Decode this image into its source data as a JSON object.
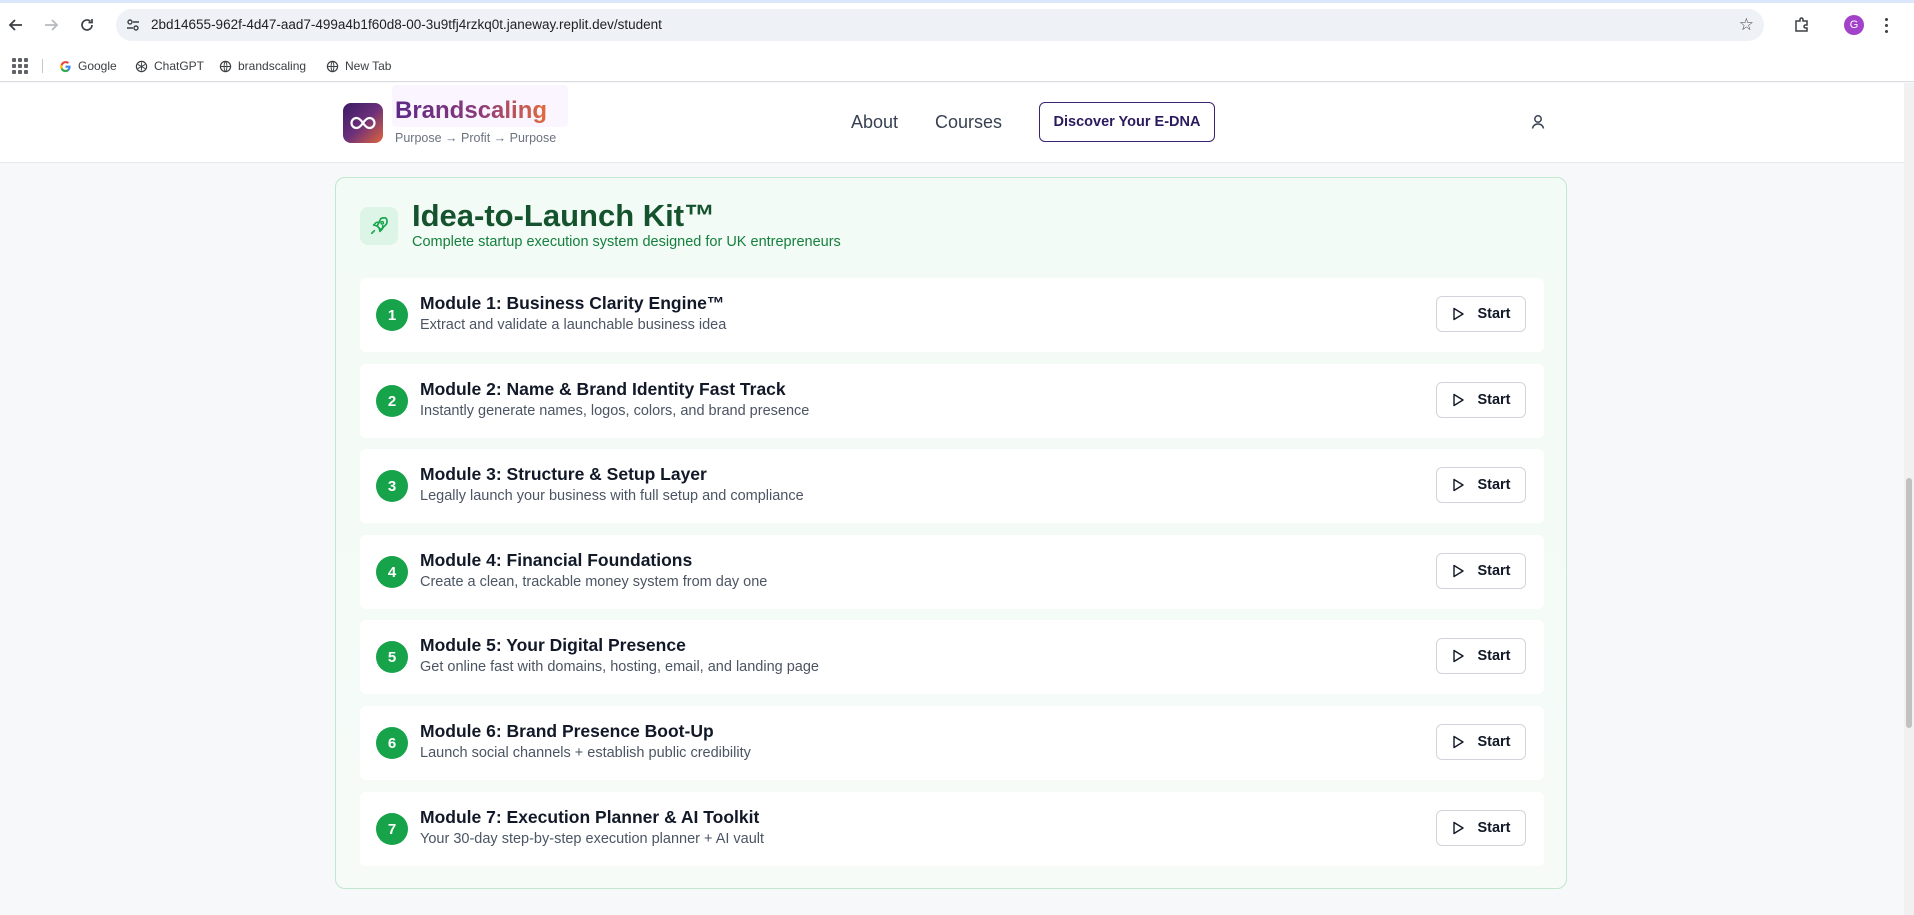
{
  "browser": {
    "url": "2bd14655-962f-4d47-aad7-499a4b1f60d8-00-3u9tfj4rzkq0t.janeway.replit.dev/student",
    "profile_initial": "G",
    "bookmarks": [
      {
        "label": "Google",
        "icon": "google-icon"
      },
      {
        "label": "ChatGPT",
        "icon": "chatgpt-icon"
      },
      {
        "label": "brandscaling",
        "icon": "globe-icon"
      },
      {
        "label": "New Tab",
        "icon": "globe-icon"
      }
    ]
  },
  "header": {
    "brand_name": "Brandscaling",
    "tagline": "Purpose → Profit → Purpose",
    "nav": {
      "about": "About",
      "courses": "Courses"
    },
    "cta": "Discover Your E-DNA",
    "logo_icon": "infinity-icon",
    "user_icon": "user-icon"
  },
  "kit": {
    "title": "Idea-to-Launch Kit™",
    "subtitle": "Complete startup execution system designed for UK entrepreneurs",
    "icon": "rocket-icon",
    "accent_color": "#16a34a",
    "modules": [
      {
        "num": "1",
        "title": "Module 1: Business Clarity Engine™",
        "desc": "Extract and validate a launchable business idea",
        "action": "Start"
      },
      {
        "num": "2",
        "title": "Module 2: Name & Brand Identity Fast Track",
        "desc": "Instantly generate names, logos, colors, and brand presence",
        "action": "Start"
      },
      {
        "num": "3",
        "title": "Module 3: Structure & Setup Layer",
        "desc": "Legally launch your business with full setup and compliance",
        "action": "Start"
      },
      {
        "num": "4",
        "title": "Module 4: Financial Foundations",
        "desc": "Create a clean, trackable money system from day one",
        "action": "Start"
      },
      {
        "num": "5",
        "title": "Module 5: Your Digital Presence",
        "desc": "Get online fast with domains, hosting, email, and landing page",
        "action": "Start"
      },
      {
        "num": "6",
        "title": "Module 6: Brand Presence Boot-Up",
        "desc": "Launch social channels + establish public credibility",
        "action": "Start"
      },
      {
        "num": "7",
        "title": "Module 7: Execution Planner & AI Toolkit",
        "desc": "Your 30-day step-by-step execution planner + AI vault",
        "action": "Start"
      }
    ]
  }
}
